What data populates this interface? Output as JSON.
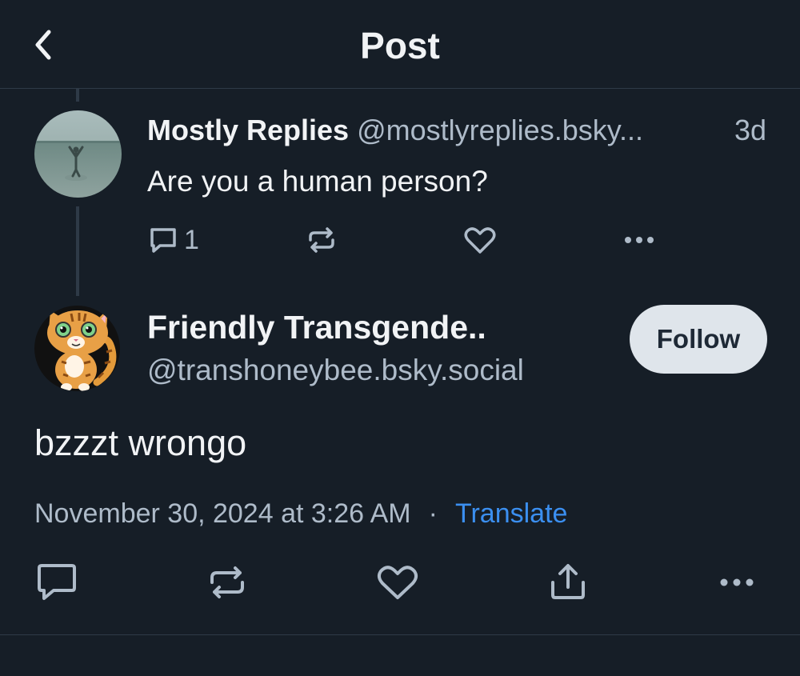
{
  "header": {
    "title": "Post",
    "back_icon": "chevron-left-icon"
  },
  "parent_post": {
    "display_name": "Mostly Replies",
    "handle": "@mostlyreplies.bsky...",
    "time": "3d",
    "text": "Are you a human person?",
    "reply_count": "1",
    "icons": {
      "reply": "comment-icon",
      "repost": "repost-icon",
      "like": "heart-icon",
      "more": "more-horizontal-icon"
    }
  },
  "main_post": {
    "display_name": "Friendly Transgende..",
    "handle": "@transhoneybee.bsky.social",
    "follow_label": "Follow",
    "text": "bzzzt wrongo",
    "timestamp": "November 30, 2024 at 3:26 AM",
    "separator": "·",
    "translate_label": "Translate",
    "icons": {
      "reply": "comment-icon",
      "repost": "repost-icon",
      "like": "heart-icon",
      "share": "share-icon",
      "more": "more-horizontal-icon"
    }
  },
  "colors": {
    "background": "#161e27",
    "text_primary": "#f1f3f5",
    "text_secondary": "#aebbc9",
    "link": "#3b8ff0",
    "divider": "#2e3a47",
    "follow_button_bg": "#dfe5eb"
  }
}
